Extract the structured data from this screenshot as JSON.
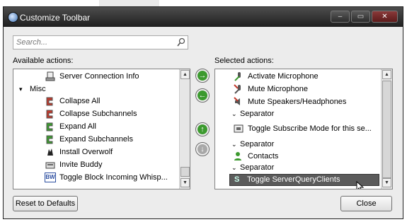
{
  "window": {
    "title": "Customize Toolbar",
    "minimize_glyph": "–",
    "maximize_glyph": "▭",
    "close_glyph": "✕"
  },
  "search": {
    "placeholder": "Search..."
  },
  "available": {
    "label": "Available actions:",
    "items": [
      {
        "label": "Server Connection Info",
        "icon": "server-info-icon"
      },
      {
        "label": "Misc",
        "icon": "collapse-triangle-icon",
        "group": true
      },
      {
        "label": "Collapse All",
        "icon": "collapse-all-icon"
      },
      {
        "label": "Collapse Subchannels",
        "icon": "collapse-subchannels-icon"
      },
      {
        "label": "Expand All",
        "icon": "expand-all-icon"
      },
      {
        "label": "Expand Subchannels",
        "icon": "expand-subchannels-icon"
      },
      {
        "label": "Install Overwolf",
        "icon": "overwolf-icon"
      },
      {
        "label": "Invite Buddy",
        "icon": "invite-buddy-icon"
      },
      {
        "label": "Toggle Block Incoming Whisp...",
        "icon": "block-whisper-icon",
        "icon_text": "BW"
      }
    ]
  },
  "selected": {
    "label": "Selected actions:",
    "items": [
      {
        "label": "Activate Microphone",
        "icon": "microphone-icon"
      },
      {
        "label": "Mute Microphone",
        "icon": "mute-microphone-icon"
      },
      {
        "label": "Mute Speakers/Headphones",
        "icon": "mute-speakers-icon"
      },
      {
        "label": "Separator",
        "icon": "separator-icon"
      },
      {
        "label": "Toggle Subscribe Mode for this se...",
        "icon": "subscribe-mode-icon"
      },
      {
        "label": "Separator",
        "icon": "separator-icon"
      },
      {
        "label": "Contacts",
        "icon": "contacts-icon"
      },
      {
        "label": "Separator",
        "icon": "separator-icon"
      },
      {
        "label": "Toggle ServerQueryClients",
        "icon": "serverquery-icon",
        "icon_text": "S",
        "selected": true
      }
    ]
  },
  "buttons": {
    "reset": "Reset to Defaults",
    "close": "Close"
  },
  "colors": {
    "accent_green": "#3c9a2f",
    "selection": "#5b5b5b",
    "titlebar": "#2b2b2b"
  }
}
